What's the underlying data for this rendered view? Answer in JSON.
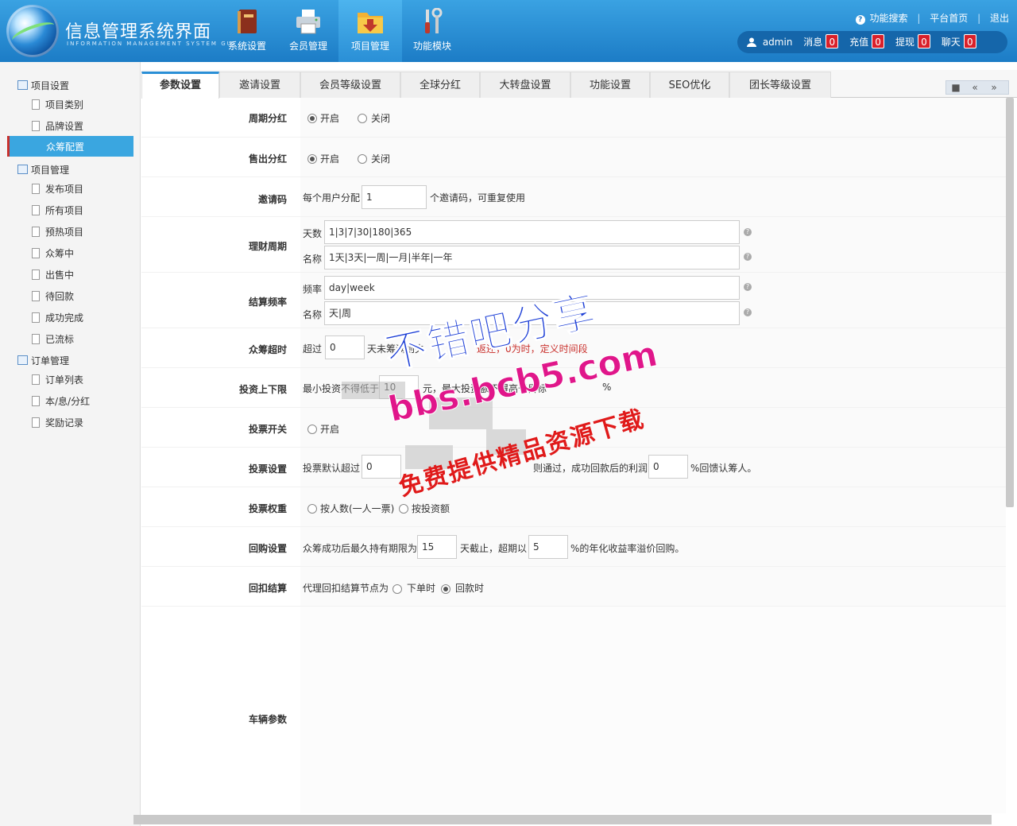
{
  "header": {
    "app_title": "信息管理系统界面",
    "app_subtitle": "INFORMATION MANAGEMENT SYSTEM GUI",
    "nav": [
      {
        "label": "系统设置",
        "icon": "book-icon"
      },
      {
        "label": "会员管理",
        "icon": "printer-icon"
      },
      {
        "label": "项目管理",
        "icon": "folder-download-icon",
        "active": true
      },
      {
        "label": "功能模块",
        "icon": "tools-icon"
      }
    ],
    "links": {
      "search": "功能搜索",
      "home": "平台首页",
      "logout": "退出"
    },
    "user": {
      "name": "admin",
      "messages_label": "消息",
      "messages_count": "0",
      "recharge_label": "充值",
      "recharge_count": "0",
      "withdraw_label": "提现",
      "withdraw_count": "0",
      "chat_label": "聊天",
      "chat_count": "0"
    }
  },
  "sidebar": {
    "group1": {
      "label": "项目设置",
      "items": [
        "项目类别",
        "品牌设置",
        "众筹配置"
      ]
    },
    "group2": {
      "label": "项目管理",
      "items": [
        "发布项目",
        "所有项目",
        "预热项目",
        "众筹中",
        "出售中",
        "待回款",
        "成功完成",
        "已流标"
      ]
    },
    "group3": {
      "label": "订单管理",
      "items": [
        "订单列表",
        "本/息/分红",
        "奖励记录"
      ]
    },
    "active_item": "众筹配置"
  },
  "tabs": [
    "参数设置",
    "邀请设置",
    "会员等级设置",
    "全球分红",
    "大转盘设置",
    "功能设置",
    "SEO优化",
    "团长等级设置"
  ],
  "tab_tools": [
    "■",
    "«",
    "»"
  ],
  "form": {
    "periodic_dividend": {
      "label": "周期分红",
      "on": "开启",
      "off": "关闭",
      "selected": "on"
    },
    "sale_dividend": {
      "label": "售出分红",
      "on": "开启",
      "off": "关闭",
      "selected": "on"
    },
    "invite_code": {
      "label": "邀请码",
      "prefix": "每个用户分配",
      "value": "1",
      "suffix": "个邀请码，可重复使用"
    },
    "finance_period": {
      "label": "理财周期",
      "days_label": "天数",
      "days_value": "1|3|7|30|180|365",
      "name_label": "名称",
      "name_value": "1天|3天|一周|一月|半年|一年"
    },
    "settle_freq": {
      "label": "结算频率",
      "freq_label": "频率",
      "freq_value": "day|week",
      "name_label": "名称",
      "name_value": "天|周"
    },
    "crowd_timeout": {
      "label": "众筹超时",
      "prefix": "超过",
      "value": "0",
      "suffix": "天未筹满则失",
      "red_text": "返还，0为时，定义时间段"
    },
    "invest_limit": {
      "label": "投资上下限",
      "prefix": "最小投资不得低于",
      "value": "10",
      "mid": "元，最大投资额不得高于目标",
      "suffix": "%"
    },
    "vote_switch": {
      "label": "投票开关",
      "on": "开启"
    },
    "vote_setting": {
      "label": "投票设置",
      "prefix": "投票默认超过",
      "value": "0",
      "mid": "则通过，成功回款后的利润",
      "value2": "0",
      "suffix": "%回馈认筹人。"
    },
    "vote_weight": {
      "label": "投票权重",
      "opt1": "按人数(一人一票)",
      "opt2": "按投资额"
    },
    "buyback": {
      "label": "回购设置",
      "prefix": "众筹成功后最久持有期限为",
      "value": "15",
      "mid": "天截止，超期以",
      "value2": "5",
      "suffix": "%的年化收益率溢价回购。"
    },
    "rebate": {
      "label": "回扣结算",
      "prefix": "代理回扣结算节点为",
      "opt1": "下单时",
      "opt2": "回款时",
      "selected": "opt2"
    },
    "vehicle": {
      "label": "车辆参数"
    }
  },
  "watermark": {
    "line1": "不错吧分享",
    "line2": "bbs.bcb5.com",
    "line3": "免费提供精品资源下载"
  }
}
